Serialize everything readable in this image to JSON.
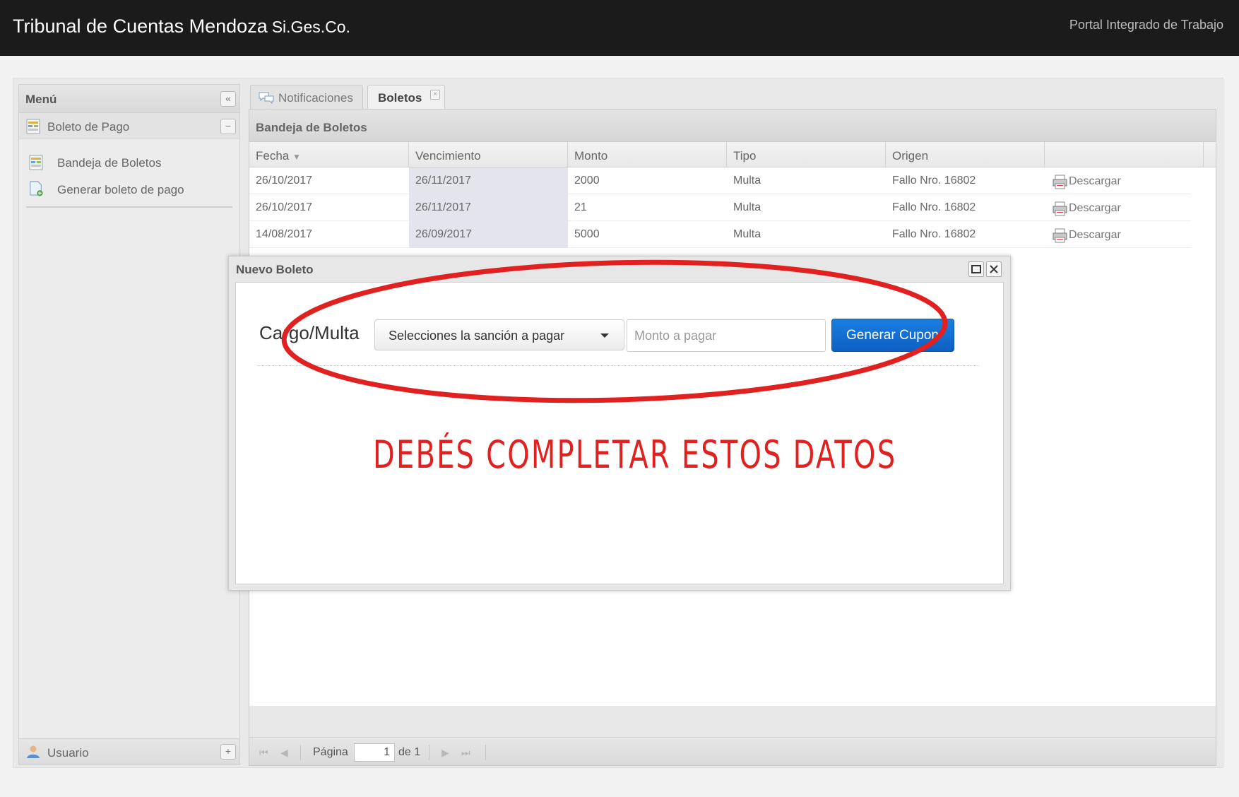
{
  "header": {
    "app_title": "Tribunal de Cuentas Mendoza",
    "app_suffix": "Si.Ges.Co.",
    "portal_label": "Portal Integrado de Trabajo"
  },
  "sidebar": {
    "title": "Menú",
    "section_label": "Boleto de Pago",
    "items": [
      {
        "label": "Bandeja de Boletos"
      },
      {
        "label": "Generar boleto de pago"
      }
    ],
    "footer_label": "Usuario"
  },
  "tabs": [
    {
      "label": "Notificaciones",
      "active": false
    },
    {
      "label": "Boletos",
      "active": true
    }
  ],
  "panel": {
    "title": "Bandeja de Boletos",
    "columns": [
      "Fecha",
      "Vencimiento",
      "Monto",
      "Tipo",
      "Origen"
    ],
    "rows": [
      {
        "fecha": "26/10/2017",
        "vencimiento": "26/11/2017",
        "monto": "2000",
        "tipo": "Multa",
        "origen": "Fallo Nro. 16802",
        "action": "Descargar"
      },
      {
        "fecha": "26/10/2017",
        "vencimiento": "26/11/2017",
        "monto": "21",
        "tipo": "Multa",
        "origen": "Fallo Nro. 16802",
        "action": "Descargar"
      },
      {
        "fecha": "14/08/2017",
        "vencimiento": "26/09/2017",
        "monto": "5000",
        "tipo": "Multa",
        "origen": "Fallo Nro. 16802",
        "action": "Descargar"
      }
    ],
    "paging": {
      "page_label": "Página",
      "page_value": "1",
      "of_label": "de 1"
    }
  },
  "modal": {
    "title": "Nuevo Boleto",
    "field_label": "Cargo/Multa",
    "select_value": "Selecciones la sanción a pagar",
    "amount_placeholder": "Monto a pagar",
    "button_label": "Generar Cupon"
  },
  "annotation": {
    "text": "DEBÉS COMPLETAR ESTOS DATOS",
    "color": "#e12020"
  },
  "colors": {
    "header_bg": "#1b1b1b",
    "primary_button": "#1a7fe0"
  }
}
